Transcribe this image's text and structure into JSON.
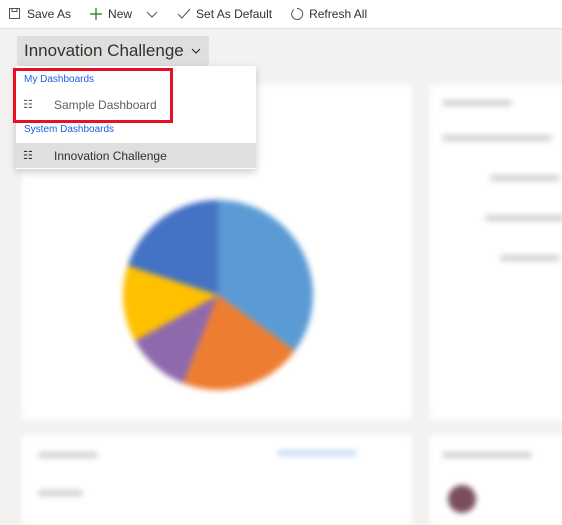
{
  "toolbar": {
    "save_as": "Save As",
    "new": "New",
    "set_default": "Set As Default",
    "refresh": "Refresh All"
  },
  "selector": {
    "title": "Innovation Challenge"
  },
  "menu": {
    "my_header": "My Dashboards",
    "my_items": [
      {
        "label": "Sample Dashboard",
        "icon": "dashboard-icon"
      }
    ],
    "system_header": "System Dashboards",
    "system_items": [
      {
        "label": "Innovation Challenge",
        "icon": "dashboard-icon",
        "selected": true
      }
    ]
  },
  "colors": {
    "highlight": "#e81123",
    "link": "#1a5ee8"
  },
  "chart_data": {
    "type": "pie",
    "values": [
      35,
      21,
      11,
      13,
      20
    ],
    "colors": [
      "#5b9bd5",
      "#ed7d31",
      "#8e6aad",
      "#ffc000",
      "#4472c4"
    ]
  }
}
